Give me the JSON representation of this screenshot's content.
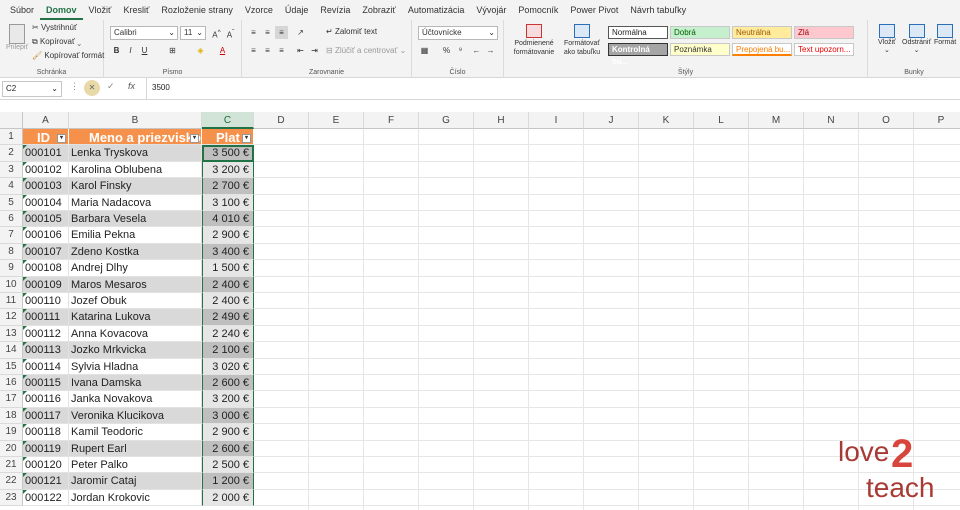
{
  "menu": [
    "Súbor",
    "Domov",
    "Vložiť",
    "Kresliť",
    "Rozloženie strany",
    "Vzorce",
    "Údaje",
    "Revízia",
    "Zobraziť",
    "Automatizácia",
    "Vývojár",
    "Pomocník",
    "Power Pivot",
    "Návrh tabuľky"
  ],
  "ribbon": {
    "clipboard": {
      "paste": "Prilepiť",
      "cut": "Vystrihnúť",
      "copy": "Kopírovať",
      "format_painter": "Kopírovať formát",
      "label": "Schránka"
    },
    "font": {
      "name": "Calibri",
      "size": "11",
      "label": "Písmo"
    },
    "alignment": {
      "wrap": "Zalomiť text",
      "merge": "Zlúčiť a centrovať",
      "label": "Zarovnanie"
    },
    "number": {
      "format": "Účtovnícke",
      "label": "Číslo"
    },
    "styles": {
      "conditional": "Podmienené formátovanie",
      "format_table": "Formátovať ako tabuľku",
      "label": "Štýly",
      "cells": [
        "Normálna",
        "Dobrá",
        "Neutrálna",
        "Zlá",
        "Kontrolná bu...",
        "Poznámka",
        "Prepojená bu...",
        "Text upozorn..."
      ]
    },
    "cells": {
      "insert": "Vložiť",
      "delete": "Odstrániť",
      "format": "Formát",
      "label": "Bunky"
    }
  },
  "formula_bar": {
    "name_box": "C2",
    "value": "3500",
    "fx": "fx"
  },
  "columns": [
    "A",
    "B",
    "C",
    "D",
    "E",
    "F",
    "G",
    "H",
    "I",
    "J",
    "K",
    "L",
    "M",
    "N",
    "O",
    "P"
  ],
  "table": {
    "headers": [
      "ID",
      "Meno a priezvisko",
      "Plat"
    ],
    "rows": [
      [
        "000101",
        "Lenka Tryskova",
        "3 500 €"
      ],
      [
        "000102",
        "Karolina Oblubena",
        "3 200 €"
      ],
      [
        "000103",
        "Karol Finsky",
        "2 700 €"
      ],
      [
        "000104",
        "Maria Nadacova",
        "3 100 €"
      ],
      [
        "000105",
        "Barbara Vesela",
        "4 010 €"
      ],
      [
        "000106",
        "Emilia Pekna",
        "2 900 €"
      ],
      [
        "000107",
        "Zdeno Kostka",
        "3 400 €"
      ],
      [
        "000108",
        "Andrej Dlhy",
        "1 500 €"
      ],
      [
        "000109",
        "Maros Mesaros",
        "2 400 €"
      ],
      [
        "000110",
        "Jozef Obuk",
        "2 400 €"
      ],
      [
        "000111",
        "Katarina Lukova",
        "2 490 €"
      ],
      [
        "000112",
        "Anna Kovacova",
        "2 240 €"
      ],
      [
        "000113",
        "Jozko Mrkvicka",
        "2 100 €"
      ],
      [
        "000114",
        "Sylvia Hladna",
        "3 020 €"
      ],
      [
        "000115",
        "Ivana Damska",
        "2 600 €"
      ],
      [
        "000116",
        "Janka Novakova",
        "3 200 €"
      ],
      [
        "000117",
        "Veronika Klucikova",
        "3 000 €"
      ],
      [
        "000118",
        "Kamil Teodoric",
        "2 900 €"
      ],
      [
        "000119",
        "Rupert Earl",
        "2 600 €"
      ],
      [
        "000120",
        "Peter Palko",
        "2 500 €"
      ],
      [
        "000121",
        "Jaromir Cataj",
        "1 200 €"
      ],
      [
        "000122",
        "Jordan Krokovic",
        "2 000 €"
      ]
    ]
  },
  "logo": {
    "part1": "love",
    "part2": "2",
    "part3": "teach"
  }
}
